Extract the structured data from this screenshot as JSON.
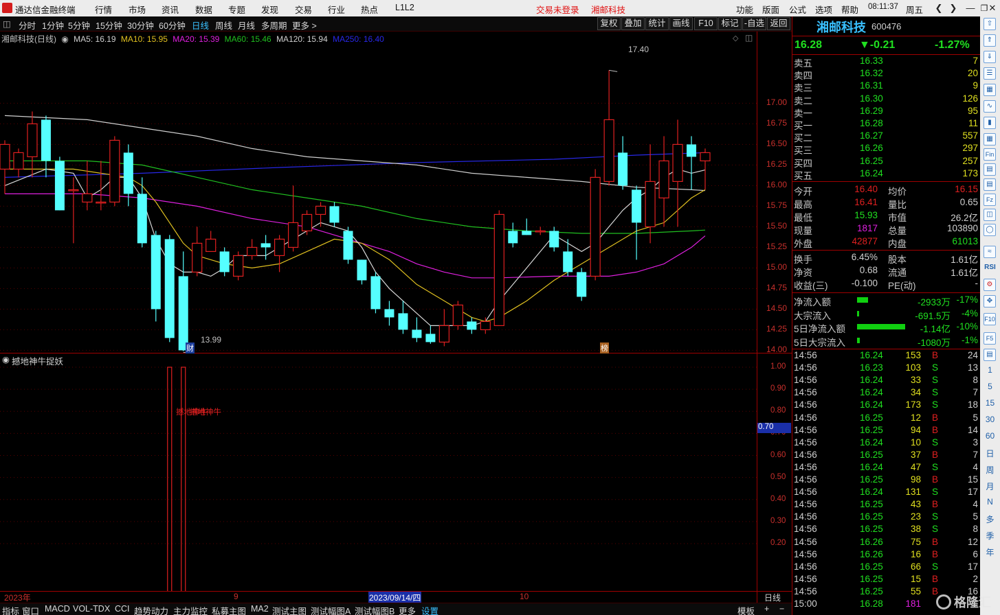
{
  "menubar": {
    "app_title": "通达信金融终端",
    "menu": [
      "行情",
      "市场",
      "资讯",
      "数据",
      "专题",
      "发现",
      "交易",
      "行业",
      "热点",
      "L1L2"
    ],
    "login_status": "交易未登录",
    "stock_name": "湘邮科技",
    "right_menu": [
      "功能",
      "版面",
      "公式",
      "选项",
      "帮助"
    ],
    "clock": "08:11:37",
    "weekday": "周五"
  },
  "toolbar": {
    "periods": [
      "分时",
      "1分钟",
      "5分钟",
      "15分钟",
      "30分钟",
      "60分钟",
      "日线",
      "周线",
      "月线",
      "多周期",
      "更多 >"
    ],
    "active": "日线",
    "buttons": [
      "复权",
      "叠加",
      "统计",
      "画线",
      "F10",
      "标记",
      "-自选",
      "返回"
    ]
  },
  "chart": {
    "title": "湘邮科技(日线)",
    "ma": [
      {
        "label": "MA5: 16.19",
        "color": "#d0d0d0"
      },
      {
        "label": "MA10: 15.95",
        "color": "#e0c020"
      },
      {
        "label": "MA20: 15.39",
        "color": "#e020e0"
      },
      {
        "label": "MA60: 15.46",
        "color": "#20c020"
      },
      {
        "label": "MA120: 15.94",
        "color": "#d0d0d0"
      },
      {
        "label": "MA250: 16.40",
        "color": "#2020e0"
      }
    ],
    "y_ticks": [
      "17.00",
      "16.75",
      "16.50",
      "16.25",
      "16.00",
      "15.75",
      "15.50",
      "15.25",
      "15.00",
      "14.75",
      "14.50",
      "14.25",
      "14.00"
    ],
    "high_label": "17.40",
    "low_label": "13.99",
    "cai_marker": "财",
    "bang_marker": "榜",
    "chart_data": {
      "type": "candlestick",
      "ylim": [
        13.92,
        17.72
      ],
      "candles": [
        [
          16.2,
          16.5,
          15.9,
          16.55
        ],
        [
          16.2,
          16.4,
          16.1,
          16.45
        ],
        [
          16.35,
          16.75,
          16.1,
          16.9
        ],
        [
          16.8,
          16.3,
          16.1,
          16.85
        ],
        [
          16.3,
          15.7,
          15.7,
          16.35
        ],
        [
          15.95,
          15.95,
          15.3,
          16.1
        ],
        [
          15.8,
          15.9,
          15.7,
          16.3
        ],
        [
          15.8,
          15.8,
          15.7,
          16.3
        ],
        [
          15.8,
          16.55,
          15.75,
          16.6
        ],
        [
          16.4,
          15.9,
          15.75,
          16.5
        ],
        [
          15.9,
          15.3,
          15.25,
          16.1
        ],
        [
          15.4,
          14.5,
          14.35,
          15.45
        ],
        [
          15.35,
          14.15,
          14.1,
          15.4
        ],
        [
          14.9,
          14.0,
          13.99,
          15.2
        ],
        [
          14.95,
          15.3,
          14.9,
          15.5
        ],
        [
          15.2,
          15.35,
          15.2,
          15.45
        ],
        [
          15.2,
          14.95,
          14.9,
          15.25
        ],
        [
          14.9,
          15.15,
          14.85,
          15.2
        ],
        [
          15.15,
          15.25,
          15.1,
          15.35
        ],
        [
          15.3,
          15.25,
          15.1,
          15.4
        ],
        [
          15.15,
          15.35,
          14.95,
          15.4
        ],
        [
          15.25,
          15.55,
          15.2,
          16.0
        ],
        [
          15.45,
          15.65,
          15.4,
          15.7
        ],
        [
          15.65,
          15.75,
          15.5,
          15.8
        ],
        [
          15.75,
          15.55,
          15.5,
          15.8
        ],
        [
          15.45,
          15.1,
          15.05,
          15.5
        ],
        [
          15.1,
          14.85,
          14.8,
          15.1
        ],
        [
          14.9,
          14.5,
          14.45,
          14.95
        ],
        [
          14.5,
          14.4,
          14.3,
          14.6
        ],
        [
          14.45,
          14.25,
          14.2,
          14.6
        ],
        [
          14.25,
          14.15,
          14.1,
          14.4
        ],
        [
          14.2,
          14.1,
          14.08,
          14.3
        ],
        [
          14.1,
          14.3,
          14.05,
          14.5
        ],
        [
          14.3,
          14.55,
          14.25,
          14.6
        ],
        [
          14.35,
          14.25,
          14.2,
          14.4
        ],
        [
          14.25,
          14.35,
          14.2,
          14.4
        ],
        [
          14.3,
          15.65,
          14.3,
          15.7
        ],
        [
          15.45,
          15.3,
          15.25,
          15.55
        ],
        [
          15.45,
          15.4,
          15.4,
          15.6
        ],
        [
          15.45,
          15.45,
          15.4,
          15.5
        ],
        [
          15.45,
          15.25,
          15.2,
          15.5
        ],
        [
          15.2,
          14.95,
          14.9,
          15.35
        ],
        [
          14.95,
          14.65,
          14.6,
          15.0
        ],
        [
          14.9,
          16.1,
          14.85,
          16.2
        ],
        [
          16.05,
          16.8,
          16.0,
          17.4
        ],
        [
          16.4,
          16.0,
          15.95,
          16.6
        ],
        [
          15.95,
          15.55,
          15.1,
          16.0
        ],
        [
          15.5,
          16.05,
          15.3,
          16.5
        ],
        [
          15.85,
          16.3,
          15.5,
          16.6
        ],
        [
          16.05,
          16.5,
          15.5,
          16.8
        ],
        [
          16.5,
          16.35,
          15.95,
          16.6
        ],
        [
          16.3,
          16.4,
          15.95,
          16.45
        ]
      ],
      "ma5": [
        [
          0,
          16.0
        ],
        [
          3,
          16.2
        ],
        [
          5,
          16.15
        ],
        [
          6,
          15.85
        ],
        [
          7,
          15.95
        ],
        [
          8,
          16.1
        ],
        [
          9,
          16.1
        ],
        [
          10,
          15.85
        ],
        [
          11,
          15.35
        ],
        [
          12,
          15.05
        ],
        [
          13,
          14.95
        ],
        [
          14,
          14.95
        ],
        [
          15,
          14.9
        ],
        [
          16,
          15.0
        ],
        [
          17,
          15.15
        ],
        [
          18,
          15.15
        ],
        [
          19,
          15.15
        ],
        [
          20,
          15.25
        ],
        [
          21,
          15.35
        ],
        [
          22,
          15.45
        ],
        [
          23,
          15.55
        ],
        [
          24,
          15.5
        ],
        [
          25,
          15.45
        ],
        [
          26,
          15.25
        ],
        [
          27,
          14.95
        ],
        [
          28,
          14.75
        ],
        [
          29,
          14.6
        ],
        [
          30,
          14.45
        ],
        [
          31,
          14.3
        ],
        [
          32,
          14.3
        ],
        [
          33,
          14.3
        ],
        [
          34,
          14.3
        ],
        [
          35,
          14.35
        ],
        [
          36,
          14.6
        ],
        [
          37,
          14.8
        ],
        [
          38,
          15.0
        ],
        [
          39,
          15.2
        ],
        [
          40,
          15.4
        ],
        [
          41,
          15.3
        ],
        [
          42,
          15.2
        ],
        [
          43,
          15.3
        ],
        [
          44,
          15.5
        ],
        [
          45,
          15.7
        ],
        [
          46,
          15.85
        ],
        [
          47,
          15.95
        ],
        [
          48,
          16.1
        ],
        [
          49,
          16.2
        ],
        [
          50,
          16.15
        ],
        [
          51,
          16.19
        ]
      ],
      "ma10": [
        [
          0,
          16.2
        ],
        [
          5,
          16.2
        ],
        [
          9,
          16.1
        ],
        [
          10,
          16.0
        ],
        [
          11,
          15.8
        ],
        [
          12,
          15.55
        ],
        [
          13,
          15.3
        ],
        [
          14,
          15.15
        ],
        [
          16,
          15.05
        ],
        [
          18,
          15.0
        ],
        [
          20,
          15.05
        ],
        [
          22,
          15.2
        ],
        [
          24,
          15.35
        ],
        [
          26,
          15.3
        ],
        [
          28,
          15.1
        ],
        [
          30,
          14.8
        ],
        [
          32,
          14.6
        ],
        [
          34,
          14.4
        ],
        [
          35,
          14.35
        ],
        [
          36,
          14.4
        ],
        [
          38,
          14.6
        ],
        [
          40,
          14.85
        ],
        [
          42,
          15.05
        ],
        [
          44,
          15.25
        ],
        [
          46,
          15.45
        ],
        [
          48,
          15.55
        ],
        [
          50,
          15.85
        ],
        [
          51,
          15.95
        ]
      ],
      "ma20": [
        [
          0,
          15.9
        ],
        [
          6,
          15.9
        ],
        [
          10,
          15.85
        ],
        [
          14,
          15.75
        ],
        [
          18,
          15.6
        ],
        [
          22,
          15.5
        ],
        [
          26,
          15.3
        ],
        [
          28,
          15.2
        ],
        [
          30,
          15.05
        ],
        [
          32,
          14.95
        ],
        [
          34,
          14.88
        ],
        [
          36,
          14.88
        ],
        [
          40,
          14.9
        ],
        [
          42,
          14.9
        ],
        [
          44,
          14.9
        ],
        [
          46,
          14.95
        ],
        [
          48,
          15.05
        ],
        [
          50,
          15.25
        ],
        [
          51,
          15.39
        ]
      ],
      "ma60": [
        [
          0,
          16.3
        ],
        [
          6,
          16.3
        ],
        [
          10,
          16.25
        ],
        [
          14,
          16.1
        ],
        [
          18,
          15.95
        ],
        [
          22,
          15.85
        ],
        [
          26,
          15.75
        ],
        [
          30,
          15.6
        ],
        [
          34,
          15.5
        ],
        [
          38,
          15.45
        ],
        [
          42,
          15.42
        ],
        [
          46,
          15.42
        ],
        [
          50,
          15.45
        ],
        [
          51,
          15.46
        ]
      ],
      "ma120": [
        [
          0,
          16.85
        ],
        [
          6,
          16.8
        ],
        [
          10,
          16.7
        ],
        [
          14,
          16.6
        ],
        [
          18,
          16.45
        ],
        [
          22,
          16.35
        ],
        [
          26,
          16.3
        ],
        [
          30,
          16.25
        ],
        [
          34,
          16.15
        ],
        [
          38,
          16.1
        ],
        [
          42,
          16.05
        ],
        [
          46,
          15.98
        ],
        [
          50,
          15.95
        ],
        [
          51,
          15.94
        ]
      ],
      "ma250": [
        [
          0,
          16.1
        ],
        [
          10,
          16.15
        ],
        [
          20,
          16.22
        ],
        [
          30,
          16.28
        ],
        [
          40,
          16.32
        ],
        [
          46,
          16.37
        ],
        [
          51,
          16.4
        ]
      ]
    }
  },
  "sub": {
    "title": "撼地神牛捉妖",
    "label": "撼地神牛",
    "value_label": "0.70",
    "y_ticks": [
      "1.00",
      "0.90",
      "0.80",
      "0.70",
      "0.60",
      "0.50",
      "0.40",
      "0.30",
      "0.20"
    ]
  },
  "dates": {
    "year": "2023年",
    "m9": "9",
    "selected": "2023/09/14/四",
    "m10": "10",
    "period": "日线"
  },
  "bottom_tabs": [
    "指标",
    "窗口",
    "MACD",
    "VOL-TDX",
    "CCI",
    "趋势动力",
    "主力监控",
    "私募主图",
    "MA2",
    "测试主图",
    "测试幅图A",
    "测试幅图B",
    "更多",
    "设置"
  ],
  "bottom_right": [
    "模板",
    "+",
    "−"
  ],
  "quote": {
    "name": "湘邮科技",
    "code": "600476",
    "price": "16.28",
    "change": "▼-0.21",
    "pct": "-1.27%",
    "asks": [
      [
        "卖五",
        "16.33",
        "7"
      ],
      [
        "卖四",
        "16.32",
        "20"
      ],
      [
        "卖三",
        "16.31",
        "9"
      ],
      [
        "卖二",
        "16.30",
        "126"
      ],
      [
        "卖一",
        "16.29",
        "95"
      ]
    ],
    "bids": [
      [
        "买一",
        "16.28",
        "11"
      ],
      [
        "买二",
        "16.27",
        "557"
      ],
      [
        "买三",
        "16.26",
        "297"
      ],
      [
        "买四",
        "16.25",
        "257"
      ],
      [
        "买五",
        "16.24",
        "173"
      ]
    ],
    "stats": [
      [
        "今开",
        "16.40",
        "均价",
        "16.15"
      ],
      [
        "最高",
        "16.41",
        "量比",
        "0.65"
      ],
      [
        "最低",
        "15.93",
        "市值",
        "26.2亿"
      ],
      [
        "现量",
        "1817",
        "总量",
        "103890"
      ],
      [
        "外盘",
        "42877",
        "内盘",
        "61013"
      ]
    ],
    "stats2": [
      [
        "换手",
        "6.45%",
        "股本",
        "1.61亿"
      ],
      [
        "净资",
        "0.68",
        "流通",
        "1.61亿"
      ],
      [
        "收益(三)",
        "-0.100",
        "PE(动)",
        "-"
      ]
    ],
    "flows": [
      [
        "净流入额",
        "-2933万",
        "-17%"
      ],
      [
        "大宗流入",
        "-691.5万",
        "-4%"
      ],
      [
        "5日净流入额",
        "-1.14亿",
        "-10%"
      ],
      [
        "5日大宗流入",
        "-1080万",
        "-1%"
      ]
    ],
    "trades": [
      [
        "14:56",
        "16.24",
        "153",
        "B",
        "24"
      ],
      [
        "14:56",
        "16.23",
        "103",
        "S",
        "13"
      ],
      [
        "14:56",
        "16.24",
        "33",
        "S",
        "8"
      ],
      [
        "14:56",
        "16.24",
        "34",
        "S",
        "7"
      ],
      [
        "14:56",
        "16.24",
        "173",
        "S",
        "18"
      ],
      [
        "14:56",
        "16.25",
        "12",
        "B",
        "5"
      ],
      [
        "14:56",
        "16.25",
        "94",
        "B",
        "14"
      ],
      [
        "14:56",
        "16.24",
        "10",
        "S",
        "3"
      ],
      [
        "14:56",
        "16.25",
        "37",
        "B",
        "7"
      ],
      [
        "14:56",
        "16.24",
        "47",
        "S",
        "4"
      ],
      [
        "14:56",
        "16.25",
        "98",
        "B",
        "15"
      ],
      [
        "14:56",
        "16.24",
        "131",
        "S",
        "17"
      ],
      [
        "14:56",
        "16.25",
        "43",
        "B",
        "4"
      ],
      [
        "14:56",
        "16.25",
        "23",
        "S",
        "5"
      ],
      [
        "14:56",
        "16.25",
        "38",
        "S",
        "8"
      ],
      [
        "14:56",
        "16.26",
        "75",
        "B",
        "12"
      ],
      [
        "14:56",
        "16.26",
        "16",
        "B",
        "6"
      ],
      [
        "14:56",
        "16.25",
        "66",
        "S",
        "17"
      ],
      [
        "14:56",
        "16.25",
        "15",
        "B",
        "2"
      ],
      [
        "14:56",
        "16.25",
        "55",
        "B",
        "16"
      ],
      [
        "15:00",
        "16.28",
        "181",
        "",
        ""
      ]
    ]
  },
  "sidebar": {
    "labels": [
      "1",
      "5",
      "15",
      "30",
      "60",
      "日",
      "周",
      "月",
      "N",
      "多",
      "季",
      "年"
    ],
    "rsi": "RSI",
    "f10": "F10",
    "f5": "F5"
  },
  "watermark": "格隆汇"
}
